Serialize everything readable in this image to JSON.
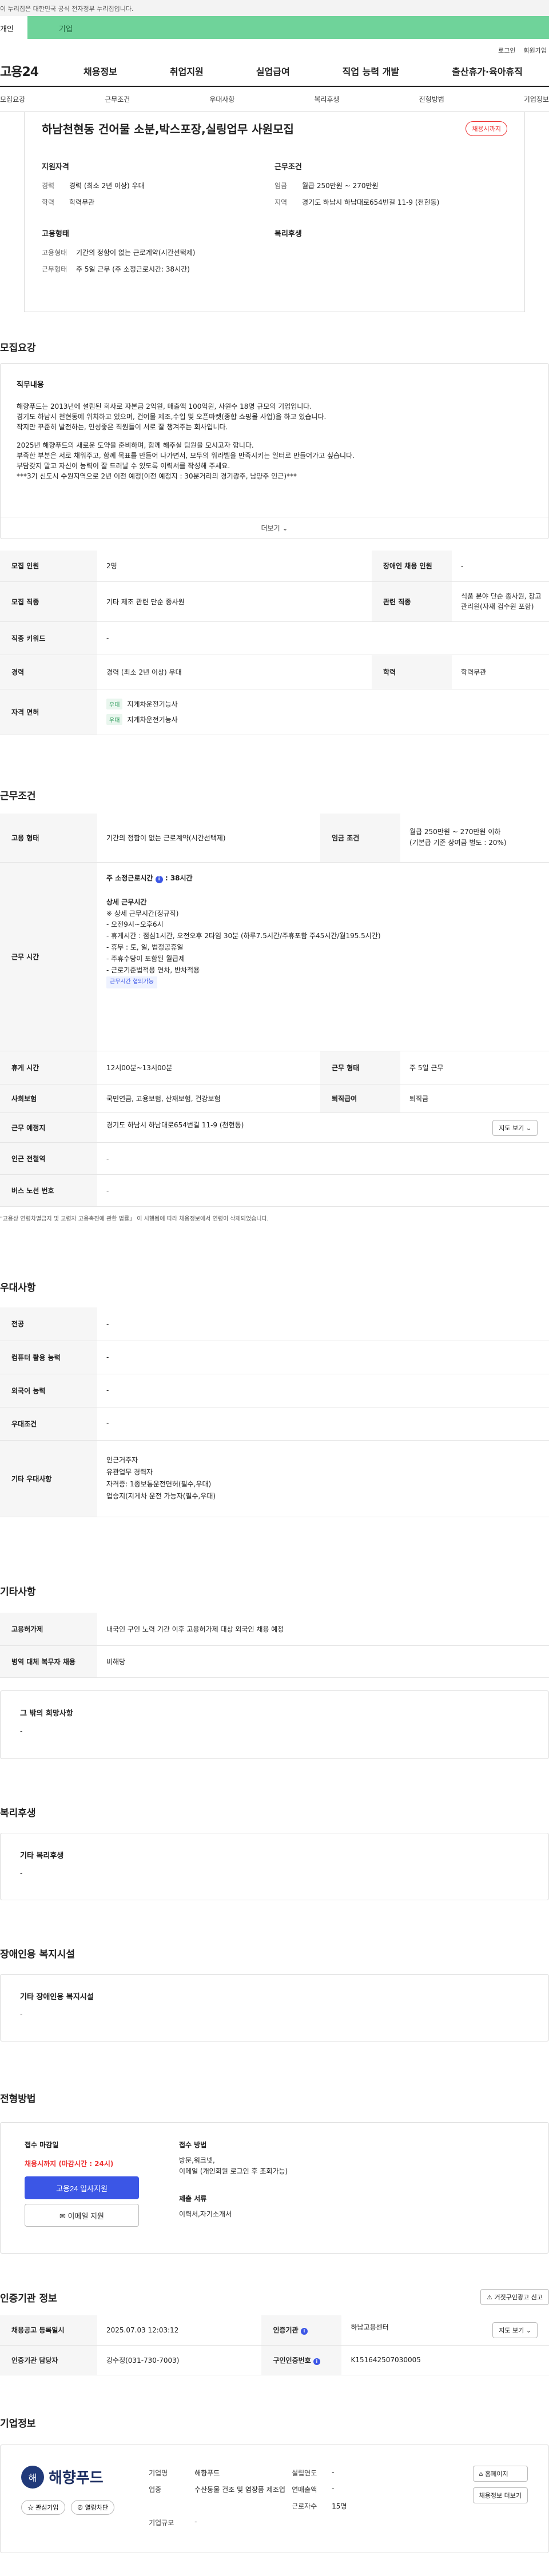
{
  "gov_banner": "이 누리집은 대한민국 공식 전자정부 누리집입니다.",
  "top_tabs": [
    "개인",
    "기업"
  ],
  "util_links": [
    "로그인",
    "회원가입"
  ],
  "brand": "고용24",
  "nav": [
    "채용정보",
    "취업지원",
    "실업급여",
    "직업 능력 개발",
    "출산휴가·육아휴직"
  ],
  "anchors": [
    "모집요강",
    "근무조건",
    "우대사항",
    "복리후생",
    "전형방법",
    "기업정보"
  ],
  "summary": {
    "title": "하남천현동 건어물 소분,박스포장,실링업무 사원모집",
    "badge": "채용시까지",
    "qual_title": "지원자격",
    "career_k": "경력",
    "career_v": "경력 (최소 2년 이상) 우대",
    "edu_k": "학력",
    "edu_v": "학력무관",
    "cond_title": "근무조건",
    "wage_k": "임금",
    "wage_v": "월급 250만원 ~ 270만원",
    "area_k": "지역",
    "area_v": "경기도 하남시 하남대로654번길 11-9 (천현동)",
    "emp_title": "고용형태",
    "emptype_k": "고용형태",
    "emptype_v": "기간의 정함이 없는 근로계약(시간선택제)",
    "worktype_k": "근무형태",
    "worktype_v": "주 5일 근무 (주 소정근로시간: 38시간)",
    "welfare_title": "복리후생"
  },
  "recruit": {
    "title": "모집요강",
    "desc_title": "직무내용",
    "desc_lines": [
      "해향푸드는 2013년에 설립된 회사로 자본금 2억원, 매출액 100억원, 사원수 18명 규모의 기업입니다.",
      "경기도 하남시 천현동에 위치하고 있으며, 건어물 제조,수입 및 오픈마켓(종합 쇼핑몰 사업)을 하고 있습니다.",
      "작지만 꾸준히 발전하는, 인성좋은 직원들이 서로 잘 챙겨주는 회사입니다.",
      "",
      "2025년 해향푸드의 새로운 도약을 준비하며, 함께 해주실 팀원을 모시고자 합니다.",
      "부족한 부분은 서로 채워주고, 함께 목표를 만들어 나가면서, 모두의 워라벨을 만족시키는 일터로 만들어가고 싶습니다.",
      "부담갖지 말고 자신이 능력이 잘 드러날 수 있도록 이력서를 작성해 주세요.",
      "***3기 신도시 수원지역으로 2년 이전 예정(이전 예정지 : 30분거리의 경기광주, 남양주 인근)***"
    ],
    "more": "더보기",
    "rows": {
      "count_k": "모집 인원",
      "count_v": "2명",
      "disabled_k": "장애인 채용 인원",
      "disabled_v": "-",
      "job_k": "모집 직종",
      "job_v": "기타 제조 관련 단순 종사원",
      "rel_k": "관련 직종",
      "rel_v": "식품 분야 단순 종사원, 창고 관리원(자재 검수원 포함)",
      "kw_k": "직종 키워드",
      "kw_v": "-",
      "career_k": "경력",
      "career_v": "경력 (최소 2년 이상) 우대",
      "edu_k": "학력",
      "edu_v": "학력무관",
      "cert_k": "자격 면허",
      "certs": [
        {
          "tag": "우대",
          "name": "지게차운전기능사"
        },
        {
          "tag": "우대",
          "name": "지게차운전기능사"
        }
      ]
    }
  },
  "work": {
    "title": "근무조건",
    "emptype_k": "고용 형태",
    "emptype_v": "기간의 정함이 없는 근로계약(시간선택제)",
    "wage_k": "임금 조건",
    "wage_v": "월급 250만원 ~ 270만원 이하",
    "wage_note": "(기본급 기준 상여금 별도 : 20%)",
    "hours_k": "근무 시간",
    "hours_main": "주 소정근로시간",
    "hours_val": "38시간",
    "detail_title": "상세 근무시간",
    "detail_lines": [
      "※ 상세 근무시간(정규직)",
      "- 오전9시~오후6시",
      "- 휴게시간 : 점심1시간, 오전오후 2타임 30분 (하루7.5시간/주휴포함 주45시간/월195.5시간)",
      "- 휴무 : 토, 일, 법정공휴일",
      "- 주휴수당이 포함된 월급제",
      "- 근로기준법적용 연차, 반차적용"
    ],
    "flex_tag": "근무시간 협의가능",
    "break_k": "휴게 시간",
    "break_v": "12시00분~13시00분",
    "form_k": "근무 형태",
    "form_v": "주 5일 근무",
    "ins_k": "사회보험",
    "ins_v": "국민연금, 고용보험, 산재보험, 건강보험",
    "sev_k": "퇴직급여",
    "sev_v": "퇴직금",
    "place_k": "근무 예정지",
    "place_v": "경기도 하남시 하남대로654번길 11-9 (천현동)",
    "map_btn": "지도 보기",
    "subway_k": "인근 전철역",
    "subway_v": "-",
    "bus_k": "버스 노선 번호",
    "bus_v": "-",
    "note": "\"고용상 연령차별금지 및 고령자 고용촉진에 관한 법률」 이 시행됨에 따라 채용정보에서 연령이 삭제되었습니다."
  },
  "pref": {
    "title": "우대사항",
    "major_k": "전공",
    "major_v": "-",
    "pc_k": "컴퓨터 활용 능력",
    "pc_v": "-",
    "lang_k": "외국어 능력",
    "lang_v": "-",
    "cond_k": "우대조건",
    "cond_v": "-",
    "etc_k": "기타 우대사항",
    "etc_lines": [
      "인근거주자",
      "유관업무 경력자",
      "자격증: 1종보통운전면허(필수,우대)",
      "업승지(지게차 운전 가능자(필수,우대)"
    ]
  },
  "other": {
    "title": "기타사항",
    "emp_k": "고용허가제",
    "emp_v": "내국인 구인 노력 기간 이후 고용허가제 대상 외국인 채용 예정",
    "mil_k": "병역 대체 복무자 채용",
    "mil_v": "비해당",
    "wish_title": "그 밖의 희망사항",
    "wish_v": "-"
  },
  "welfare": {
    "title": "복리후생",
    "sub": "기타 복리후생",
    "v": "-"
  },
  "disabled": {
    "title": "장애인용 복지시설",
    "sub": "기타 장애인용 복지시설",
    "v": "-"
  },
  "apply": {
    "title": "전형방법",
    "deadline_k": "접수 마감일",
    "deadline_v": "채용시까지 (마감시간 : 24시)",
    "apply_btn": "고용24 입사지원",
    "email_btn": "이메일 지원",
    "method_k": "접수 방법",
    "method_v1": "방문,워크넷,",
    "method_v2": "이메일 (개인회원 로그인 후 조회가능)",
    "docs_k": "제출 서류",
    "docs_v": "이력서,자기소개서"
  },
  "agency": {
    "title": "인증기관 정보",
    "report_btn": "거짓구인광고 신고",
    "reg_k": "채용공고 등록일시",
    "reg_v": "2025.07.03 12:03:12",
    "org_k": "인증기관",
    "org_v": "하남고용센터",
    "map_btn": "지도 보기",
    "mgr_k": "인증기관 담당자",
    "mgr_v": "강수정(031-730-7003)",
    "no_k": "구인인증번호",
    "no_v": "K151642507030005"
  },
  "company": {
    "title": "기업정보",
    "logo_mark": "해",
    "logo_text": "해향푸드",
    "interest_btn": "관심기업",
    "block_btn": "열람차단",
    "name_k": "기업명",
    "name_v": "해향푸드",
    "year_k": "설립연도",
    "year_v": "-",
    "biz_k": "업종",
    "biz_v": "수산동물 건조 및 염장품 제조업",
    "sales_k": "연매출액",
    "sales_v": "-",
    "emp_k": "근로자수",
    "emp_v": "15명",
    "type_k": "기업규모",
    "type_v": "-",
    "home_btn": "홈페이지",
    "jobs_btn": "채용정보 더보기"
  }
}
